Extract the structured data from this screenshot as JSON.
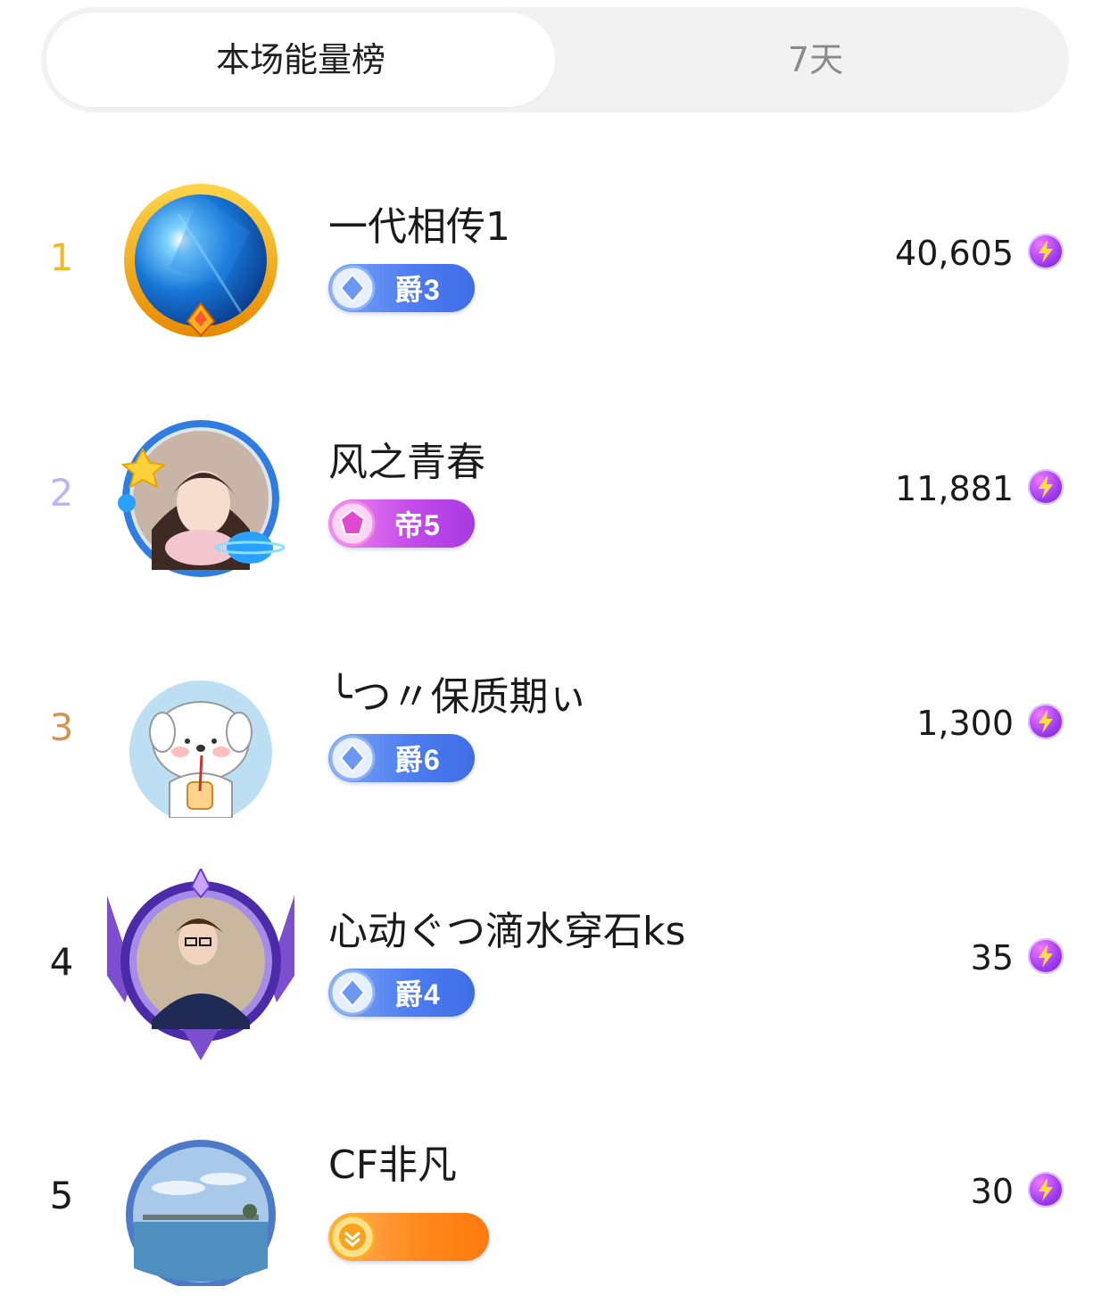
{
  "tabs": [
    {
      "label": "本场能量榜",
      "active": true
    },
    {
      "label": "7天",
      "active": false
    }
  ],
  "rank_colors": {
    "1": "#f2b824",
    "2": "#b9b6f4",
    "3": "#d49454",
    "default": "#1a1a1a"
  },
  "rows": [
    {
      "rank": "1",
      "name": "一代相传1",
      "badge": "爵3",
      "badge_style": "blue",
      "score": "40,605",
      "score_icon": "energy-bolt-icon",
      "avatar_icon": "blue-light-avatar-icon"
    },
    {
      "rank": "2",
      "name": "风之青春",
      "badge": "帝5",
      "badge_style": "pink",
      "score": "11,881",
      "score_icon": "energy-bolt-icon",
      "avatar_icon": "girl-photo-avatar-icon"
    },
    {
      "rank": "3",
      "name": "╰つ〃保质期ぃ",
      "badge": "爵6",
      "badge_style": "blue",
      "score": "1,300",
      "score_icon": "energy-bolt-icon",
      "avatar_icon": "white-dog-avatar-icon"
    },
    {
      "rank": "4",
      "name": "心动ぐつ滴水穿石ks",
      "badge": "爵4",
      "badge_style": "blue",
      "score": "35",
      "score_icon": "energy-bolt-icon",
      "avatar_icon": "boy-photo-avatar-icon"
    },
    {
      "rank": "5",
      "name": "CF非凡",
      "badge": "",
      "badge_style": "orange",
      "score": "30",
      "score_icon": "energy-bolt-icon",
      "avatar_icon": "sea-photo-avatar-icon"
    }
  ]
}
